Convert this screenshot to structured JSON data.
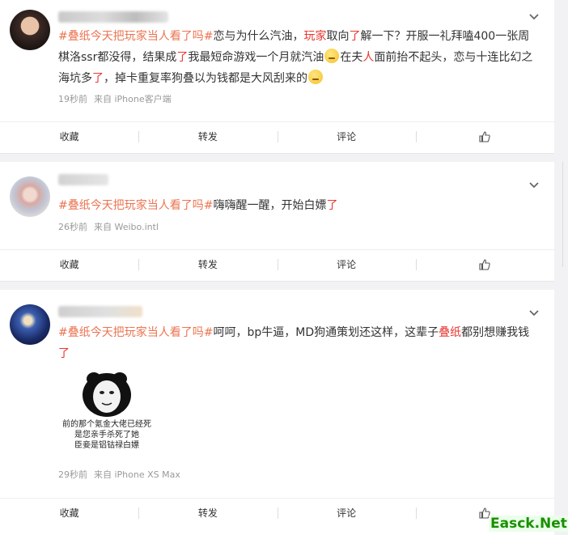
{
  "actions": {
    "collect": "收藏",
    "forward": "转发",
    "comment": "评论"
  },
  "posts": [
    {
      "content": {
        "tag": "#叠纸今天把玩家当人看了吗#",
        "p1": "恋与为什么汽油，",
        "p2": "玩家",
        "p3": "取向",
        "p4": "了",
        "p5": "解一下？开服一礼拜嗑400一张周棋洛ssr都没得，结果成",
        "p6": "了",
        "p7": "我最短命游戏一个月就汽油",
        "p8": "在夫",
        "p9": "人",
        "p10": "面前抬不起头，恋与十连比幻之海坑多",
        "p11": "了",
        "p12": "，掉卡重复率狗叠以为钱都是大风刮来的"
      },
      "time": "19秒前",
      "source": "来自 iPhone客户端"
    },
    {
      "content": {
        "tag": "#叠纸今天把玩家当人看了吗#",
        "p1": "嗨嗨醒一醒，开始白嫖",
        "p2": "了"
      },
      "time": "26秒前",
      "source": "来自 Weibo.intl"
    },
    {
      "content": {
        "tag": "#叠纸今天把玩家当人看了吗#",
        "p1": "呵呵，bp牛逼，MD狗通策划还这样，这辈子",
        "p2": "叠纸",
        "p3": "都别想赚我钱",
        "p4": "了"
      },
      "meme_text": [
        "前的那个氪金大佬已经死",
        "是您亲手杀死了她",
        "臣妾是铝钴禄白嫖"
      ],
      "time": "29秒前",
      "source": "来自 iPhone XS Max"
    }
  ],
  "watermark": "Easck.Net",
  "colors": {
    "tag": "#eb7350",
    "highlight": "#e8352d",
    "meta": "#999999",
    "background": "#f2f2f5"
  },
  "icons": [
    "chevron-down-icon",
    "thumbs-up-icon",
    "emoji-icon"
  ]
}
